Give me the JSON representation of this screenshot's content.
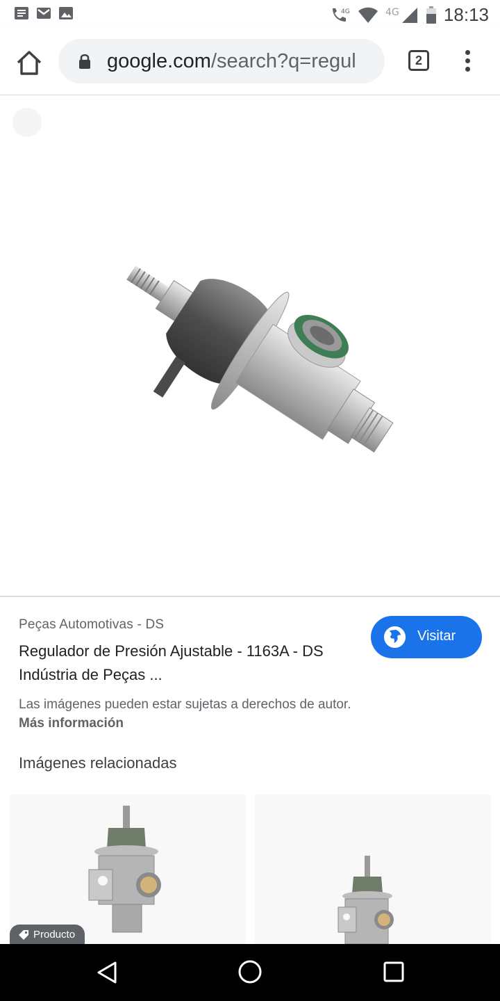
{
  "status_bar": {
    "time": "18:13",
    "network_label_1": "4G",
    "network_label_2": "4G",
    "icons": [
      "notes-icon",
      "gmail-icon",
      "gallery-icon",
      "wifi-call-icon",
      "wifi-icon",
      "signal-icon",
      "battery-icon"
    ]
  },
  "browser": {
    "url_host": "google.com",
    "url_path": "/search?q=regul",
    "tab_count": "2",
    "icons": [
      "home-icon",
      "lock-icon",
      "menu-icon"
    ]
  },
  "viewer": {
    "close_icon": "close-icon"
  },
  "result": {
    "source": "Peças Automotivas - DS",
    "title": "Regulador de Presión Ajustable - 1163A - DS Indústria de Peças ...",
    "visit_label": "Visitar",
    "copyright_notice": "Las imágenes pueden estar sujetas a derechos de autor.",
    "more_info": "Más información"
  },
  "related": {
    "heading": "Imágenes relacionadas",
    "badge": "Producto"
  },
  "colors": {
    "accent": "#1a73e8",
    "seal_green": "#3f7d54"
  }
}
